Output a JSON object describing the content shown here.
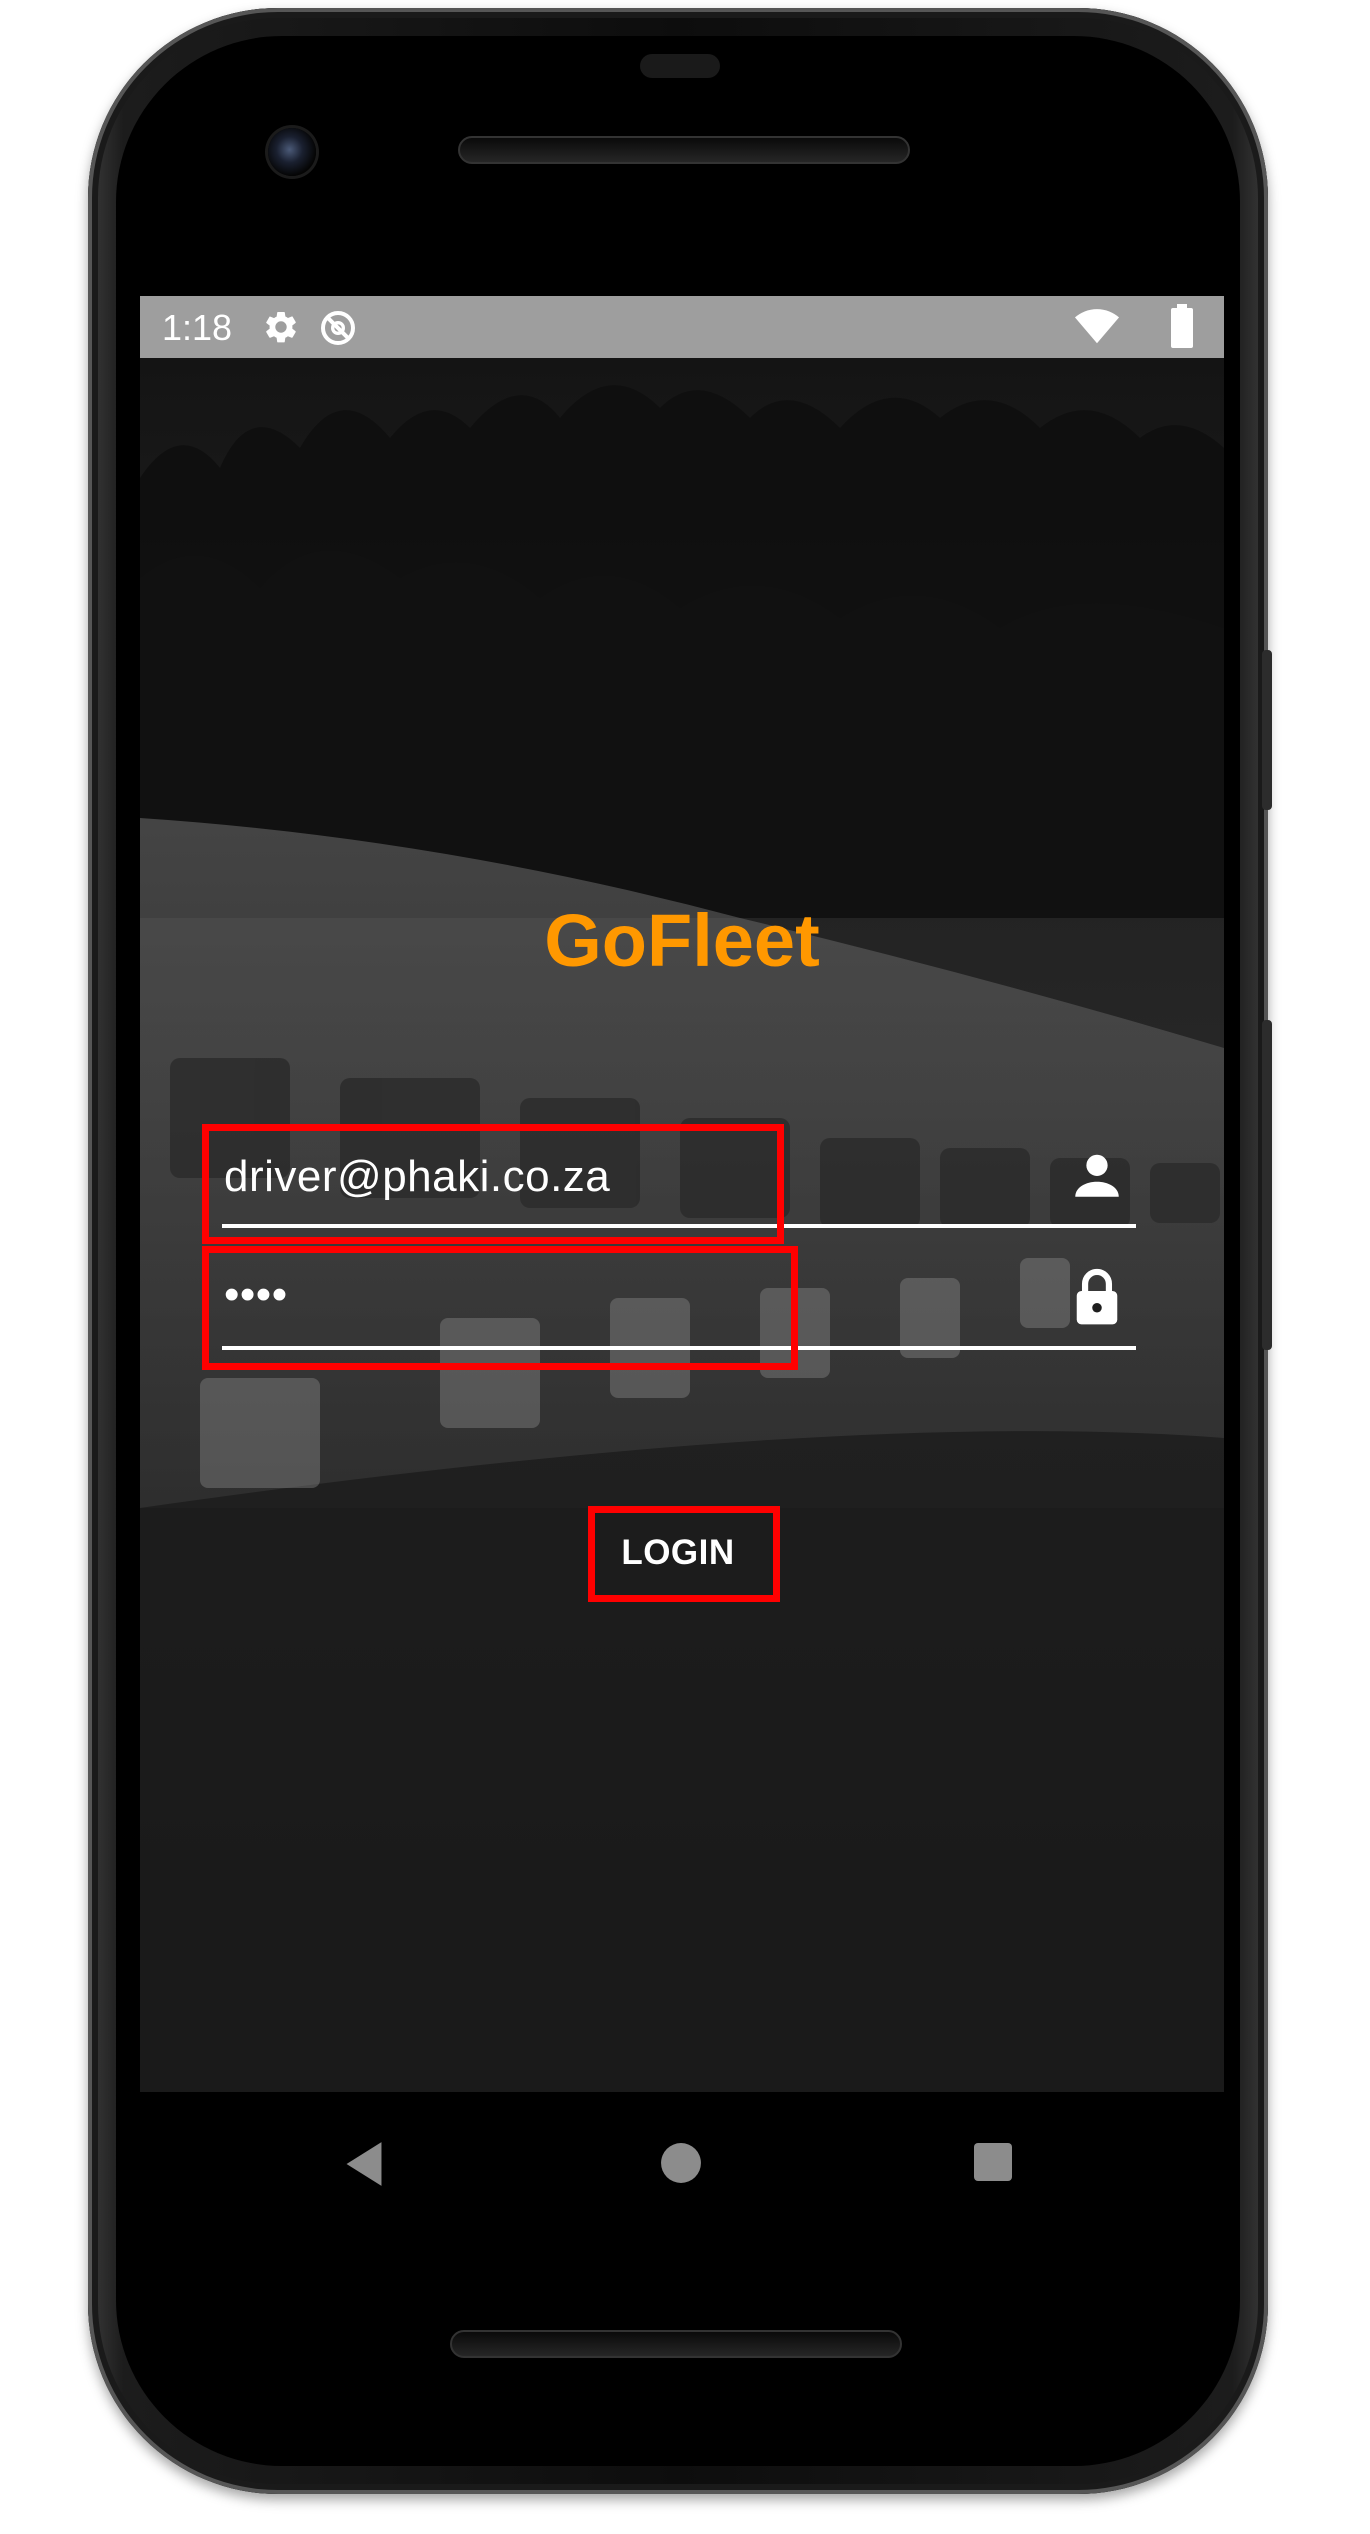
{
  "status_bar": {
    "time": "1:18",
    "icons": [
      "gear-icon",
      "no-location-icon",
      "wifi-icon",
      "battery-icon"
    ]
  },
  "app": {
    "title": "GoFleet",
    "email_value": "driver@phaki.co.za",
    "password_value": "••••",
    "login_label": "LOGIN",
    "brand_color": "#ff9800",
    "highlight_color": "#ff0000"
  },
  "nav_bar": {
    "icons": [
      "back-icon",
      "home-icon",
      "recents-icon"
    ]
  }
}
